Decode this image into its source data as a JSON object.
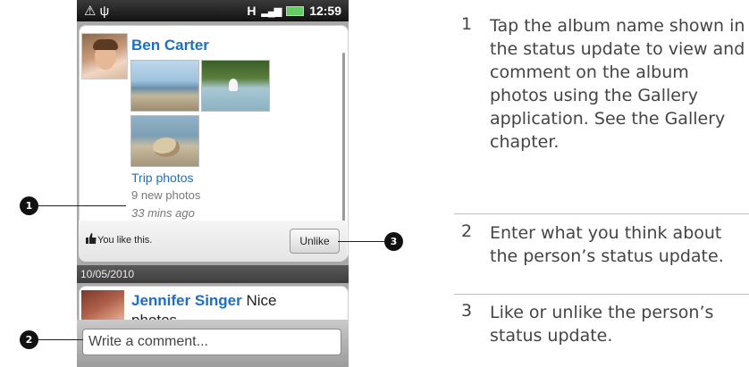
{
  "status_bar": {
    "icons_left": [
      "warning-icon",
      "usb-icon"
    ],
    "icons_right": [
      "data-h-icon",
      "signal-icon",
      "battery-icon"
    ],
    "time": "12:59",
    "h_label": "H"
  },
  "post1": {
    "author": "Ben Carter",
    "album_link": "Trip photos",
    "photo_count": "9 new photos",
    "time_ago": "33 mins ago",
    "like_text": "You like this.",
    "unlike_label": "Unlike"
  },
  "date_header": "10/05/2010",
  "post2": {
    "author": "Jennifer Singer",
    "text_first": "Nice",
    "text_second": "photos"
  },
  "comment": {
    "placeholder": "Write a comment..."
  },
  "callouts": [
    "1",
    "2",
    "3"
  ],
  "legend": [
    {
      "num": "1",
      "text": "Tap the album name shown in the status update to view and comment on the album photos using the Gallery application. See the Gallery chapter."
    },
    {
      "num": "2",
      "text": "Enter what you think about the person’s status update."
    },
    {
      "num": "3",
      "text": "Like or unlike the person’s status update."
    }
  ]
}
